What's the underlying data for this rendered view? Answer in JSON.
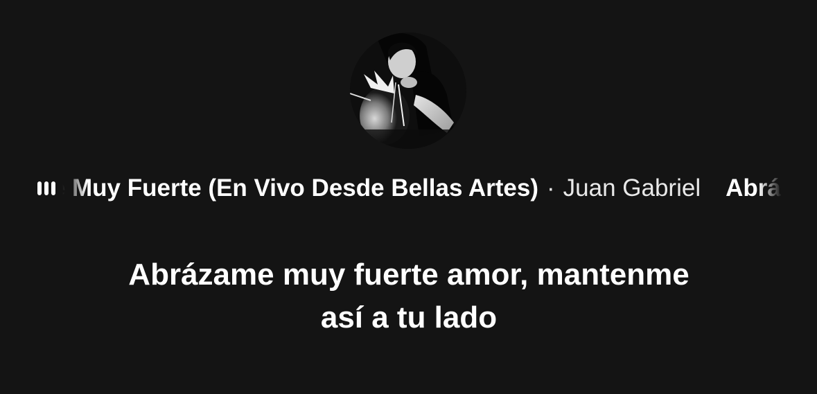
{
  "player": {
    "artwork_icon": "singer-photo-avatar",
    "playing_icon": "equalizer-bars-icon",
    "song_title": "Abrázame Muy Fuerte (En Vivo Desde Bellas Artes)",
    "separator": "·",
    "artist": "Juan Gabriel",
    "song_title_repeat": "Abrázame Muy Fuerte (En Vivo Desde Bellas Artes)"
  },
  "lyrics": {
    "line1": "Abrázame muy fuerte amor, mantenme",
    "line2": "así a tu lado"
  },
  "colors": {
    "background": "#141414",
    "text": "#ffffff"
  }
}
